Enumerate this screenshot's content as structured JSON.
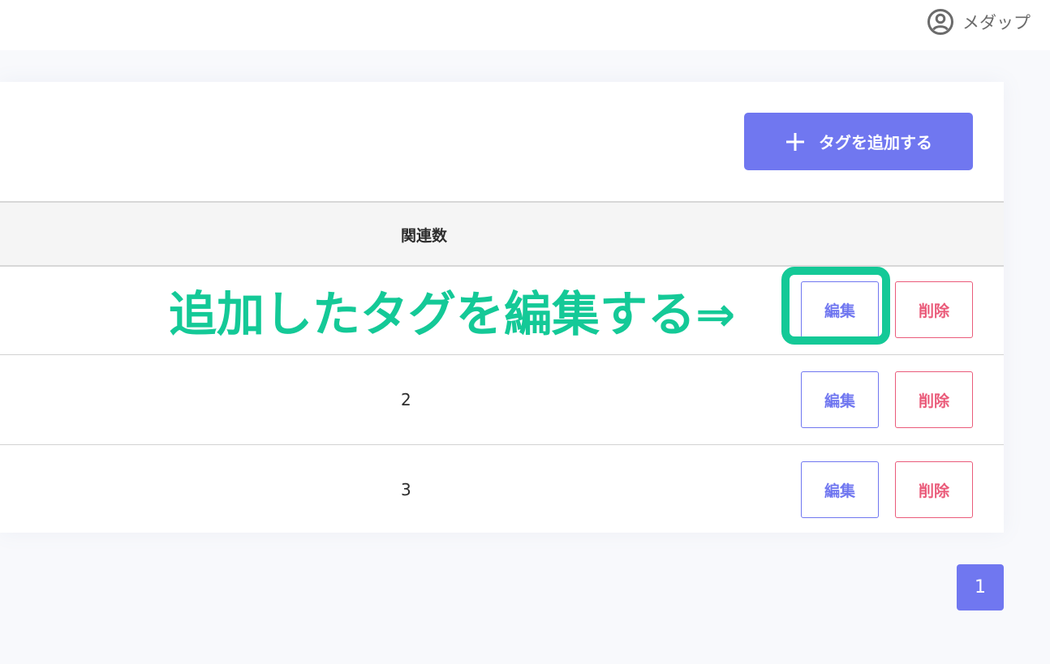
{
  "header": {
    "user_name": "メダップ",
    "user_icon": "user-circle-icon"
  },
  "toolbar": {
    "add_tag_label": "タグを追加する",
    "add_icon": "plus-icon"
  },
  "table": {
    "columns": [
      "関連数"
    ],
    "rows": [
      {
        "count": "",
        "edit_label": "編集",
        "delete_label": "削除"
      },
      {
        "count": "2",
        "edit_label": "編集",
        "delete_label": "削除"
      },
      {
        "count": "3",
        "edit_label": "編集",
        "delete_label": "削除"
      }
    ]
  },
  "annotation": {
    "text": "追加したタグを編集する⇒"
  },
  "pagination": {
    "current_page": "1"
  },
  "colors": {
    "primary": "#7077f0",
    "danger": "#ea5b7a",
    "annotation": "#14c997"
  }
}
